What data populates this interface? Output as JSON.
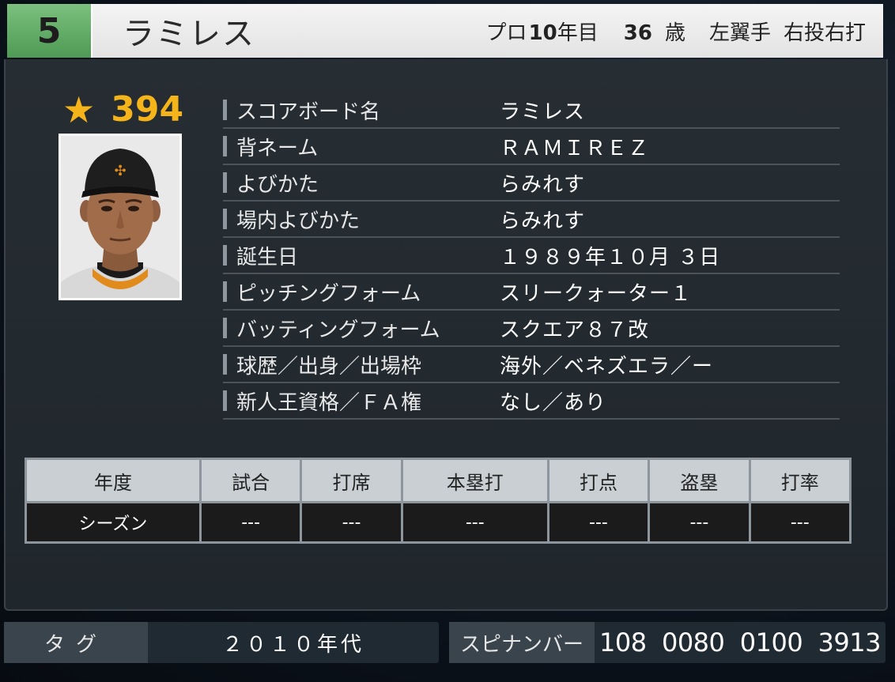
{
  "header": {
    "uniform_number": "5",
    "name": "ラミレス",
    "pro_prefix": "プロ",
    "pro_years": "10",
    "pro_suffix": "年目",
    "age": "36",
    "age_unit": "歳",
    "position": "左翼手",
    "throw_bat": "右投右打"
  },
  "rating": {
    "value": "394"
  },
  "info": [
    {
      "label": "スコアボード名",
      "value": "ラミレス"
    },
    {
      "label": "背ネーム",
      "value": "ＲＡＭＩＲＥＺ"
    },
    {
      "label": "よびかた",
      "value": "らみれす"
    },
    {
      "label": "場内よびかた",
      "value": "らみれす"
    },
    {
      "label": "誕生日",
      "value": "１９８９年１０月 ３日"
    },
    {
      "label": "ピッチングフォーム",
      "value": "スリークォーター１"
    },
    {
      "label": "バッティングフォーム",
      "value": "スクエア８７改"
    },
    {
      "label": "球歴／出身／出場枠",
      "value": "海外／ベネズエラ／ー"
    },
    {
      "label": "新人王資格／ＦＡ権",
      "value": "なし／あり"
    }
  ],
  "stats": {
    "headers": [
      "年度",
      "試合",
      "打席",
      "本塁打",
      "打点",
      "盗塁",
      "打率"
    ],
    "row": [
      "シーズン",
      "---",
      "---",
      "---",
      "---",
      "---",
      "---"
    ]
  },
  "bottom": {
    "tag_label": "タグ",
    "tag_value": "２０１０年代",
    "spin_label": "スピナンバー",
    "spin_value": "108  0080  0100  3913"
  },
  "colors": {
    "number_box": "#5fae64",
    "rating": "#f5b51a"
  },
  "icons": {
    "rating": "star-icon"
  }
}
